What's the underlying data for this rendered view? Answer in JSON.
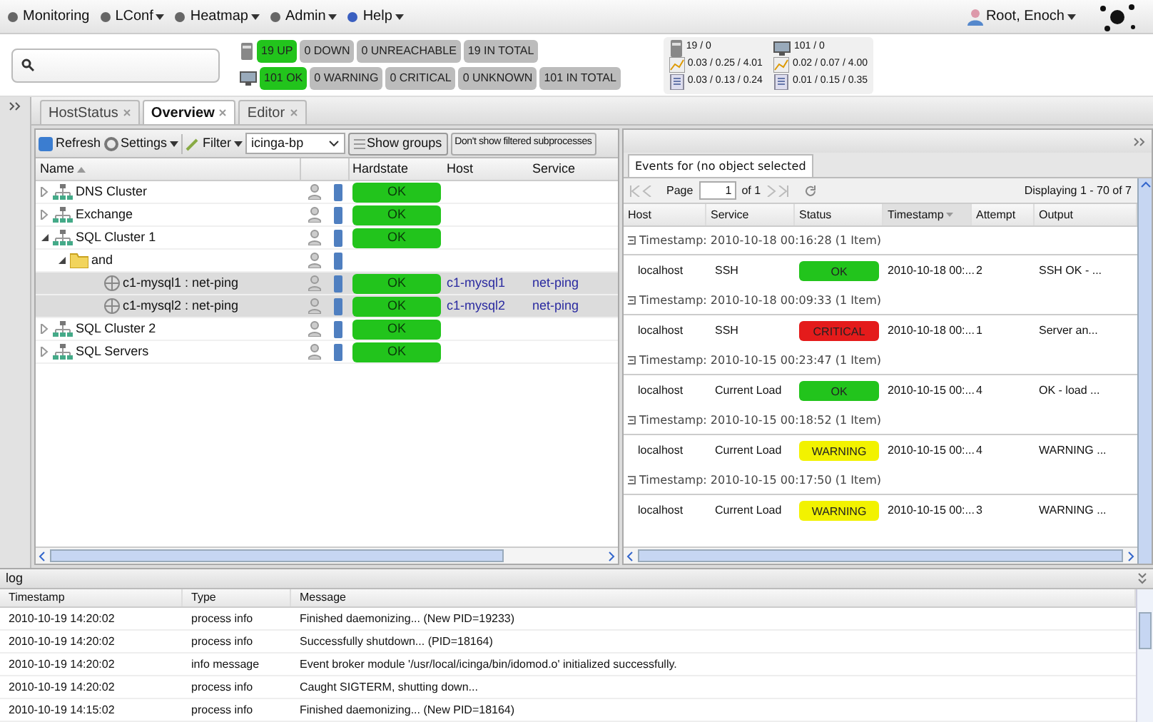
{
  "menu": {
    "items": [
      {
        "label": "Monitoring",
        "dropdown": false
      },
      {
        "label": "LConf",
        "dropdown": true
      },
      {
        "label": "Heatmap",
        "dropdown": true
      },
      {
        "label": "Admin",
        "dropdown": true
      },
      {
        "label": "Help",
        "dropdown": true
      }
    ],
    "user": "Root, Enoch"
  },
  "host_summary": [
    {
      "label": "19 UP",
      "color": "#22c41c"
    },
    {
      "label": "0 DOWN",
      "color": "#bcbcbc"
    },
    {
      "label": "0 UNREACHABLE",
      "color": "#bcbcbc"
    },
    {
      "label": "19 IN TOTAL",
      "color": "#bcbcbc"
    }
  ],
  "service_summary": [
    {
      "label": "101 OK",
      "color": "#22c41c"
    },
    {
      "label": "0 WARNING",
      "color": "#bcbcbc"
    },
    {
      "label": "0 CRITICAL",
      "color": "#bcbcbc"
    },
    {
      "label": "0 UNKNOWN",
      "color": "#bcbcbc"
    },
    {
      "label": "101 IN TOTAL",
      "color": "#bcbcbc"
    }
  ],
  "stats": [
    {
      "kind": "hosts",
      "text": "19 / 0"
    },
    {
      "kind": "services",
      "text": "101 / 0"
    },
    {
      "kind": "load",
      "text": "0.03 / 0.25 / 4.01"
    },
    {
      "kind": "load",
      "text": "0.02 / 0.07 / 4.00"
    },
    {
      "kind": "latency",
      "text": "0.03 / 0.13 / 0.24"
    },
    {
      "kind": "latency",
      "text": "0.01 / 0.15 / 0.35"
    }
  ],
  "tabs": [
    {
      "label": "HostStatus",
      "selected": false
    },
    {
      "label": "Overview",
      "selected": true
    },
    {
      "label": "Editor",
      "selected": false
    }
  ],
  "toolbar": {
    "refresh": "Refresh",
    "settings": "Settings",
    "filter": "Filter",
    "combo": "icinga-bp",
    "show_groups": "Show groups",
    "filtered": "Don't show filtered subprocesses"
  },
  "tree": {
    "columns": [
      "Name",
      "Hardstate",
      "Host",
      "Service"
    ],
    "rows": [
      {
        "name": "DNS Cluster",
        "kind": "group",
        "expanded": false,
        "selected": false,
        "hardstate": "OK"
      },
      {
        "name": "Exchange",
        "kind": "group",
        "expanded": false,
        "selected": false,
        "hardstate": "OK"
      },
      {
        "name": "SQL Cluster 1",
        "kind": "group",
        "expanded": true,
        "selected": false,
        "hardstate": "OK",
        "children": [
          {
            "name": "and",
            "kind": "operator",
            "expanded": true,
            "selected": false,
            "children": [
              {
                "name": "c1-mysql1 : net-ping",
                "kind": "service",
                "selected": true,
                "hardstate": "OK",
                "host": "c1-mysql1",
                "service": "net-ping"
              },
              {
                "name": "c1-mysql2 : net-ping",
                "kind": "service",
                "selected": true,
                "hardstate": "OK",
                "host": "c1-mysql2",
                "service": "net-ping"
              }
            ]
          }
        ]
      },
      {
        "name": "SQL Cluster 2",
        "kind": "group",
        "expanded": false,
        "selected": false,
        "hardstate": "OK"
      },
      {
        "name": "SQL Servers",
        "kind": "group",
        "expanded": false,
        "selected": false,
        "hardstate": "OK"
      }
    ]
  },
  "events": {
    "tab": "Events for (no object selected",
    "page_label": "Page",
    "page": "1",
    "of": "of 1",
    "displaying": "Displaying 1 - 70 of 7",
    "columns": [
      "Host",
      "Service",
      "Status",
      "Timestamp",
      "Attempt",
      "Output"
    ],
    "groups": [
      {
        "title": "Timestamp: 2010-10-18 00:16:28 (1 Item)",
        "row": {
          "host": "localhost",
          "service": "SSH",
          "status": "OK",
          "color": "#22c41c",
          "timestamp": "2010-10-18 00:...",
          "attempt": "2",
          "output": "SSH OK - ..."
        }
      },
      {
        "title": "Timestamp: 2010-10-18 00:09:33 (1 Item)",
        "row": {
          "host": "localhost",
          "service": "SSH",
          "status": "CRITICAL",
          "color": "#e41b1b",
          "timestamp": "2010-10-18 00:...",
          "attempt": "1",
          "output": "Server an..."
        }
      },
      {
        "title": "Timestamp: 2010-10-15 00:23:47 (1 Item)",
        "row": {
          "host": "localhost",
          "service": "Current Load",
          "status": "OK",
          "color": "#22c41c",
          "timestamp": "2010-10-15 00:...",
          "attempt": "4",
          "output": "OK - load ..."
        }
      },
      {
        "title": "Timestamp: 2010-10-15 00:18:52 (1 Item)",
        "row": {
          "host": "localhost",
          "service": "Current Load",
          "status": "WARNING",
          "color": "#f2f200",
          "timestamp": "2010-10-15 00:...",
          "attempt": "4",
          "output": "WARNING ..."
        }
      },
      {
        "title": "Timestamp: 2010-10-15 00:17:50 (1 Item)",
        "row": {
          "host": "localhost",
          "service": "Current Load",
          "status": "WARNING",
          "color": "#f2f200",
          "timestamp": "2010-10-15 00:...",
          "attempt": "3",
          "output": "WARNING ..."
        }
      }
    ]
  },
  "log": {
    "title": "log",
    "columns": [
      "Timestamp",
      "Type",
      "Message"
    ],
    "rows": [
      [
        "2010-10-19 14:20:02",
        "process info",
        "Finished daemonizing... (New PID=19233)"
      ],
      [
        "2010-10-19 14:20:02",
        "process info",
        "Successfully shutdown... (PID=18164)"
      ],
      [
        "2010-10-19 14:20:02",
        "info message",
        "Event broker module '/usr/local/icinga/bin/idomod.o' initialized successfully."
      ],
      [
        "2010-10-19 14:20:02",
        "process info",
        "Caught SIGTERM, shutting down..."
      ],
      [
        "2010-10-19 14:15:02",
        "process info",
        "Finished daemonizing... (New PID=18164)"
      ]
    ]
  }
}
